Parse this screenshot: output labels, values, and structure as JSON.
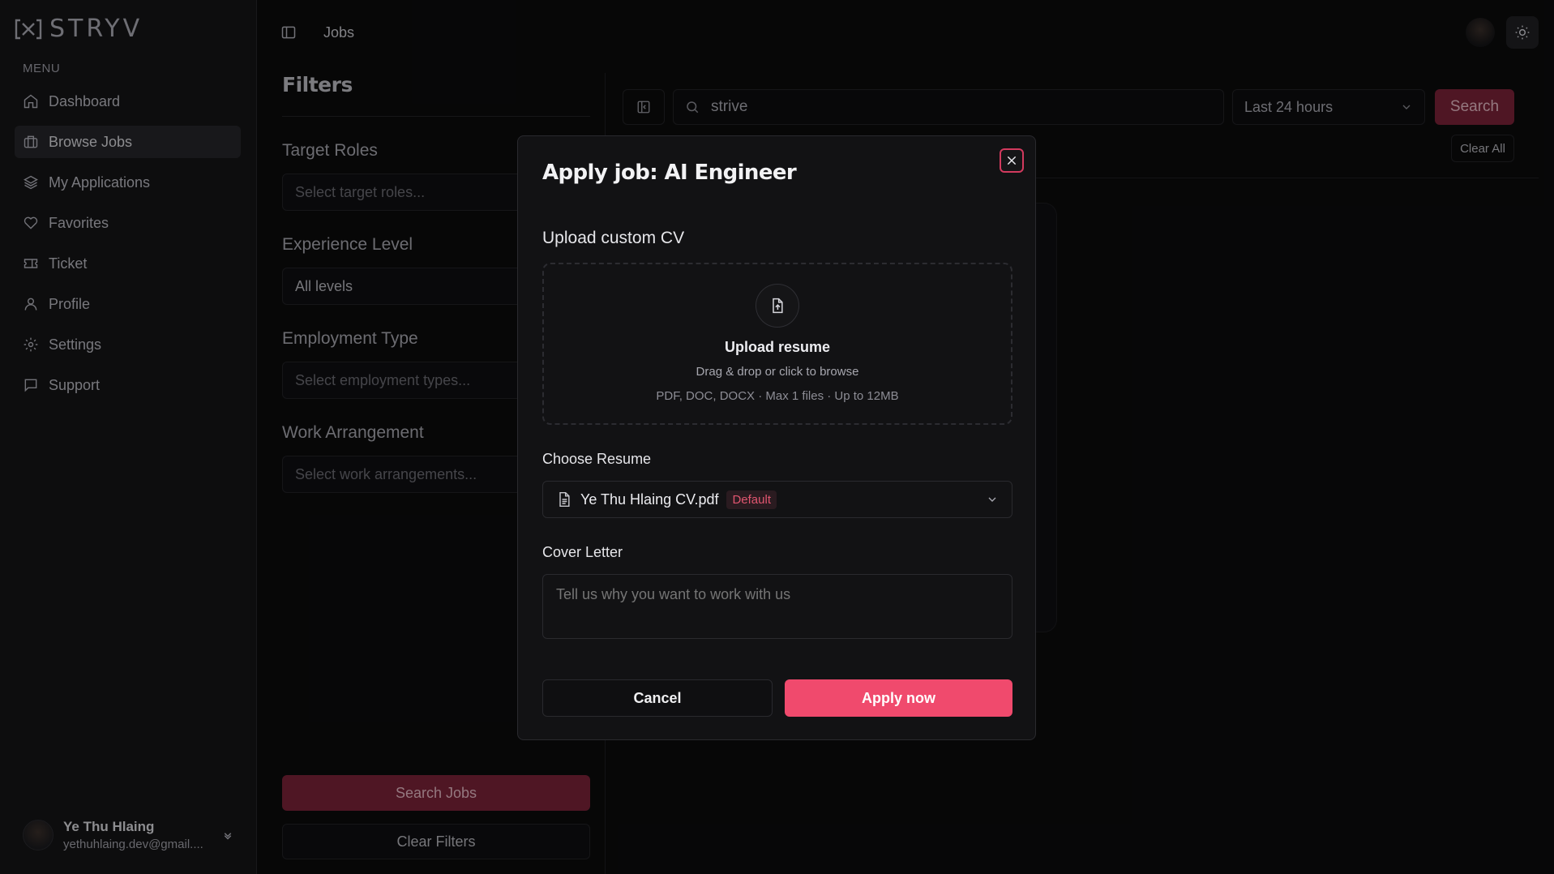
{
  "app": {
    "brand": "STRYV"
  },
  "sidebar": {
    "menu_label": "MENU",
    "items": [
      {
        "label": "Dashboard",
        "icon": "home-icon"
      },
      {
        "label": "Browse Jobs",
        "icon": "briefcase-icon",
        "active": true
      },
      {
        "label": "My Applications",
        "icon": "layers-icon"
      },
      {
        "label": "Favorites",
        "icon": "heart-icon"
      },
      {
        "label": "Ticket",
        "icon": "ticket-icon"
      },
      {
        "label": "Profile",
        "icon": "user-icon"
      },
      {
        "label": "Settings",
        "icon": "gear-icon"
      },
      {
        "label": "Support",
        "icon": "message-icon"
      }
    ],
    "user": {
      "name": "Ye Thu Hlaing",
      "email": "yethuhlaing.dev@gmail...."
    }
  },
  "header": {
    "breadcrumb": "Jobs"
  },
  "filters": {
    "title": "Filters",
    "target_roles": {
      "label": "Target Roles",
      "placeholder": "Select target roles..."
    },
    "experience": {
      "label": "Experience Level",
      "value": "All levels"
    },
    "employment": {
      "label": "Employment Type",
      "placeholder": "Select employment types..."
    },
    "work": {
      "label": "Work Arrangement",
      "placeholder": "Select work arrangements..."
    },
    "search_button": "Search Jobs",
    "clear_button": "Clear Filters"
  },
  "search": {
    "query": "strive",
    "time_range": "Last 24 hours",
    "button": "Search",
    "clear_all": "Clear All"
  },
  "modal": {
    "title": "Apply job: AI Engineer",
    "upload_heading": "Upload custom CV",
    "upload_title": "Upload resume",
    "upload_sub": "Drag & drop or click to browse",
    "upload_meta": "PDF, DOC, DOCX · Max 1 files · Up to 12MB",
    "choose_label": "Choose Resume",
    "resume_name": "Ye Thu Hlaing CV.pdf",
    "resume_badge": "Default",
    "cover_label": "Cover Letter",
    "cover_placeholder": "Tell us why you want to work with us",
    "cancel": "Cancel",
    "apply": "Apply now"
  },
  "colors": {
    "accent": "#f04a6d",
    "accent_dim": "#7a2238",
    "bg": "#0b0b0c",
    "sidebar": "#141416"
  }
}
